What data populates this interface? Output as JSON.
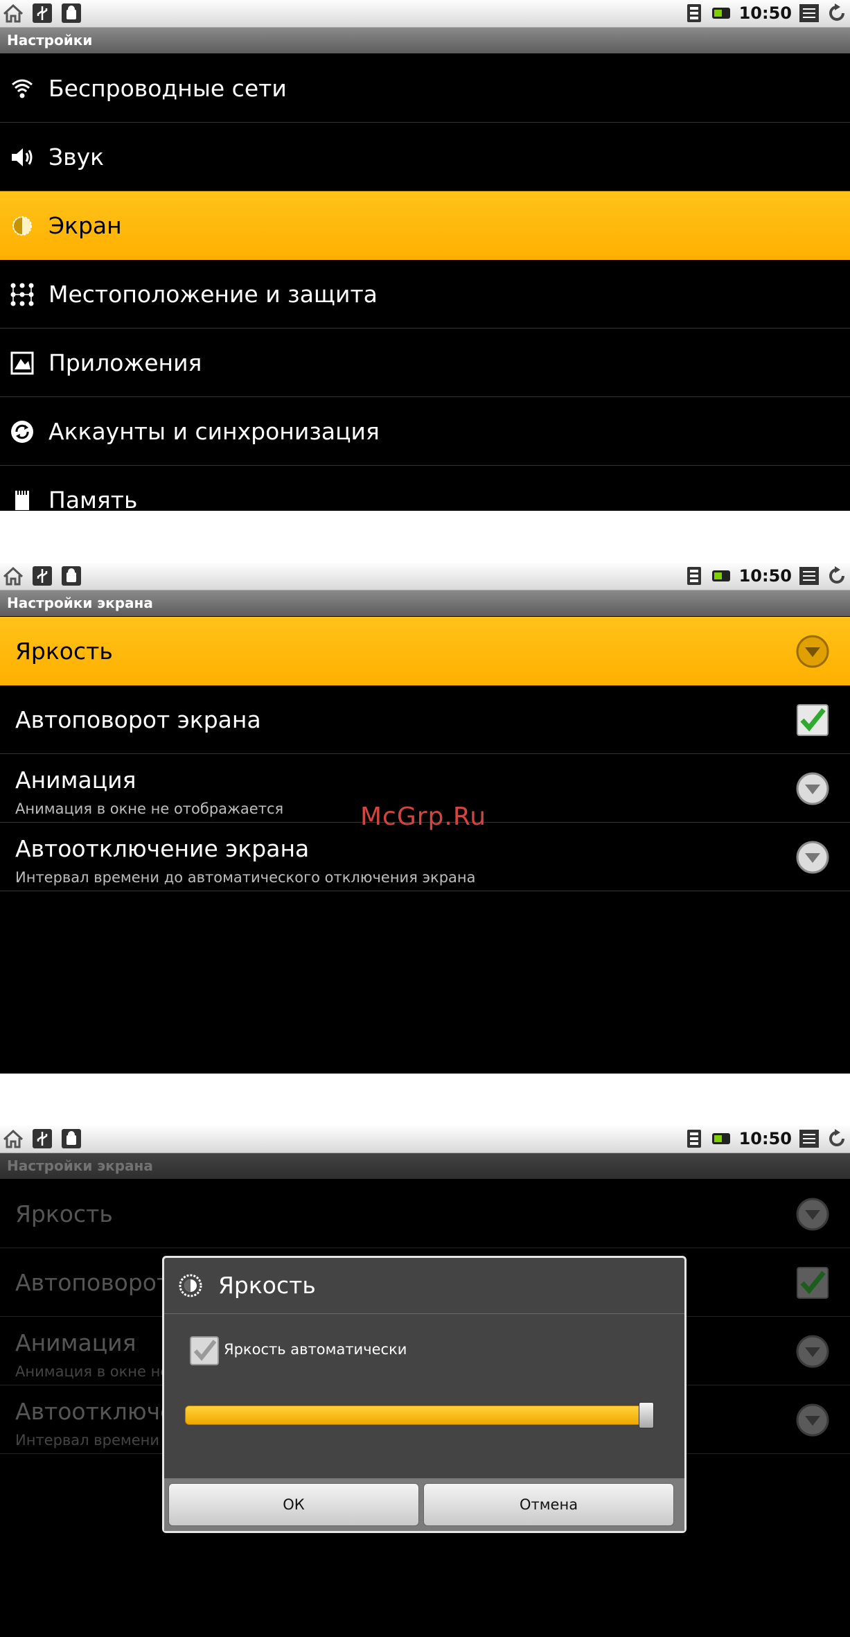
{
  "status_bar": {
    "time": "10:50"
  },
  "screen1": {
    "title": "Настройки",
    "items": [
      {
        "label": "Беспроводные сети",
        "icon": "wifi-icon"
      },
      {
        "label": "Звук",
        "icon": "speaker-icon"
      },
      {
        "label": "Экран",
        "icon": "brightness-icon",
        "selected": true
      },
      {
        "label": "Местоположение и защита",
        "icon": "grid-lock-icon"
      },
      {
        "label": "Приложения",
        "icon": "apps-icon"
      },
      {
        "label": "Аккаунты и синхронизация",
        "icon": "sync-icon"
      },
      {
        "label": "Память",
        "icon": "sdcard-icon"
      }
    ]
  },
  "screen2": {
    "title": "Настройки экрана",
    "items": [
      {
        "title": "Яркость",
        "subtitle": "",
        "control": "dropdown",
        "selected": true
      },
      {
        "title": "Автоповорот экрана",
        "subtitle": "",
        "control": "checkbox-checked"
      },
      {
        "title": "Анимация",
        "subtitle": "Анимация в окне не отображается",
        "control": "dropdown"
      },
      {
        "title": "Автоотключение экрана",
        "subtitle": "Интервал времени до автоматического отключения экрана",
        "control": "dropdown"
      }
    ]
  },
  "screen3": {
    "title": "Настройки экрана",
    "dialog": {
      "title": "Яркость",
      "auto_label": "Яркость автоматически",
      "auto_checked": true,
      "brightness_level": 0.98,
      "ok_label": "ОК",
      "cancel_label": "Отмена"
    }
  },
  "watermark": "McGrp.Ru",
  "colors": {
    "accent": "#ffb300",
    "check_green": "#2eaa2e"
  }
}
